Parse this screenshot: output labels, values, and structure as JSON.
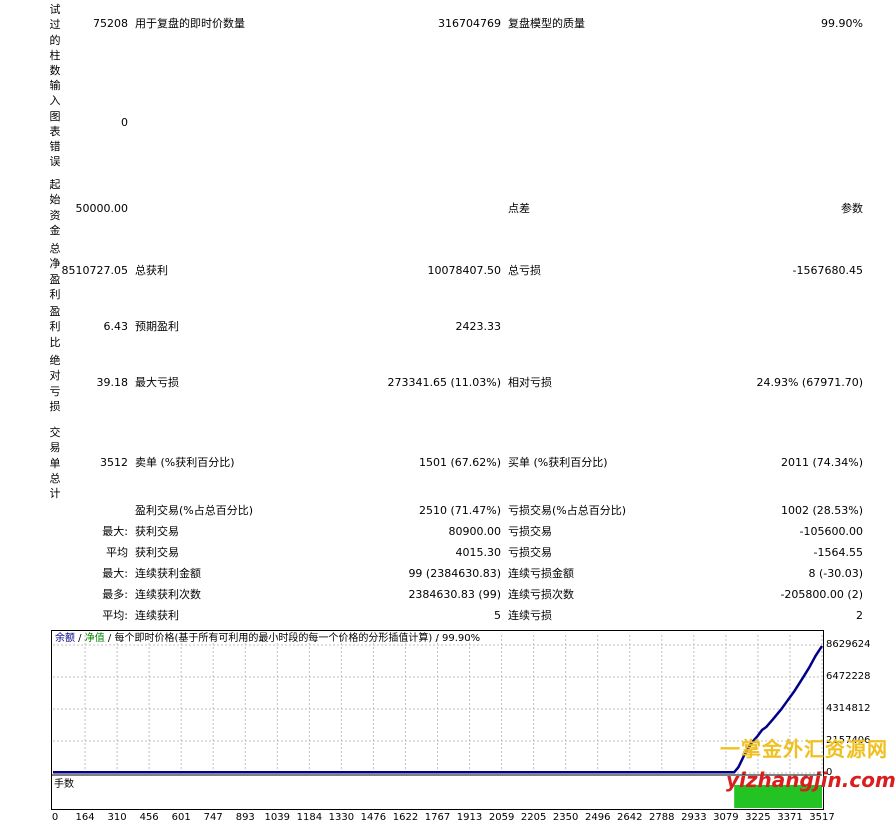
{
  "left_labels": {
    "bars": "试过的柱数",
    "input_errors": "输入图表错误",
    "initial_deposit": "起始资金",
    "total_net_profit": "总净盈利",
    "profit_factor": "盈利比",
    "absolute_drawdown": "绝对亏损",
    "total_trades": "交易单总计"
  },
  "values": {
    "bars": "75208",
    "input_errors": "0",
    "initial_deposit": "50000.00",
    "total_net_profit": "8510727.05",
    "profit_factor": "6.43",
    "absolute_drawdown": "39.18",
    "total_trades": "3512"
  },
  "rows": {
    "ticks_label": "用于复盘的即时价数量",
    "ticks_value": "316704769",
    "quality_label": "复盘模型的质量",
    "quality_value": "99.90%",
    "spread_label": "点差",
    "spread_value": "参数",
    "gross_profit_label": "总获利",
    "gross_profit_value": "10078407.50",
    "gross_loss_label": "总亏损",
    "gross_loss_value": "-1567680.45",
    "expected_payoff_label": "预期盈利",
    "expected_payoff_value": "2423.33",
    "max_drawdown_label": "最大亏损",
    "max_drawdown_value": "273341.65 (11.03%)",
    "rel_drawdown_label": "相对亏损",
    "rel_drawdown_value": "24.93% (67971.70)",
    "short_label": "卖单 (%获利百分比)",
    "short_value": "1501 (67.62%)",
    "long_label": "买单 (%获利百分比)",
    "long_value": "2011 (74.34%)",
    "profit_trades_label": "盈利交易(%占总百分比)",
    "profit_trades_value": "2510 (71.47%)",
    "loss_trades_label": "亏损交易(%占总百分比)",
    "loss_trades_value": "1002 (28.53%)",
    "largest_prefix": "最大:",
    "largest_profit_label": "获利交易",
    "largest_profit_value": "80900.00",
    "largest_loss_label": "亏损交易",
    "largest_loss_value": "-105600.00",
    "average_prefix": "平均",
    "avg_profit_label": "获利交易",
    "avg_profit_value": "4015.30",
    "avg_loss_label": "亏损交易",
    "avg_loss_value": "-1564.55",
    "max_consec_prefix": "最大:",
    "max_consec_wins_label": "连续获利金额",
    "max_consec_wins_value": "99 (2384630.83)",
    "max_consec_losses_label": "连续亏损金额",
    "max_consec_losses_value": "8 (-30.03)",
    "most_prefix": "最多:",
    "max_consec_profit_label": "连续获利次数",
    "max_consec_profit_value": "2384630.83 (99)",
    "max_consec_loss_label": "连续亏损次数",
    "max_consec_loss_value": "-205800.00 (2)",
    "avg_consec_prefix": "平均:",
    "avg_consec_wins_label": "连续获利",
    "avg_consec_wins_value": "5",
    "avg_consec_losses_label": "连续亏损",
    "avg_consec_losses_value": "2"
  },
  "chart": {
    "legend_balance": "余额",
    "legend_sep1": " / ",
    "legend_equity": "净值",
    "legend_sep2": " / ",
    "legend_text": "每个即时价格(基于所有可利用的最小时段的每一个价格的分形插值计算) / 99.90%",
    "volume_label": "手数",
    "colors": {
      "balance": "#00008b",
      "equity": "#008000",
      "grid": "#c0c0c0"
    }
  },
  "watermark": {
    "line1": "一掌金外汇资源网",
    "line2": "yizhangjin.com"
  },
  "chart_data": {
    "type": "line",
    "title": "",
    "xlabel": "",
    "ylabel": "",
    "x_ticks": [
      "0",
      "164",
      "310",
      "456",
      "601",
      "747",
      "893",
      "1039",
      "1184",
      "1330",
      "1476",
      "1622",
      "1767",
      "1913",
      "2059",
      "2205",
      "2350",
      "2496",
      "2642",
      "2788",
      "2933",
      "3079",
      "3225",
      "3371",
      "3517"
    ],
    "y_ticks": [
      "8629624",
      "6472228",
      "4314812",
      "2157406",
      "0"
    ],
    "ylim": [
      0,
      8629624
    ],
    "xlim": [
      0,
      3590
    ],
    "series": [
      {
        "name": "余额",
        "x": [
          0,
          1000,
          2000,
          3000,
          3180,
          3200,
          3230,
          3260,
          3290,
          3310,
          3330,
          3360,
          3400,
          3430,
          3460,
          3500,
          3530,
          3560,
          3590
        ],
        "values": [
          50000,
          50000,
          50000,
          50000,
          50000,
          400000,
          1300000,
          2000000,
          2500000,
          2900000,
          3100000,
          3600000,
          4300000,
          4900000,
          5500000,
          6400000,
          7100000,
          7900000,
          8560727
        ]
      }
    ],
    "volume": {
      "x_start": 3180,
      "x_end": 3590,
      "level_fraction": 0.72
    },
    "grid": true
  }
}
